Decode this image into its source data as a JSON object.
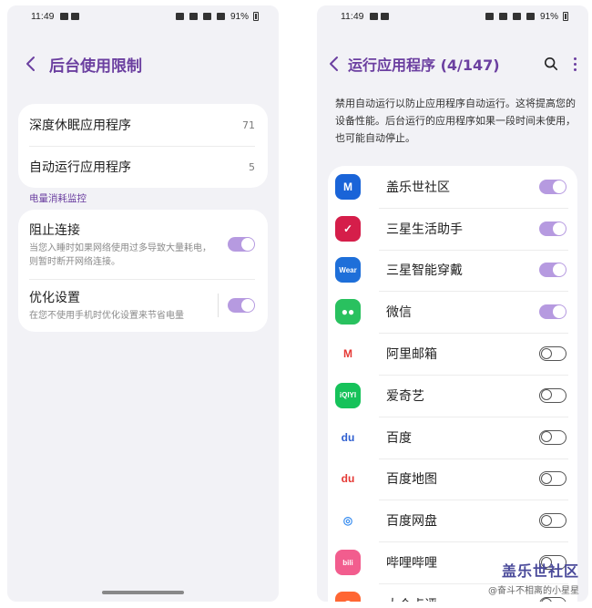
{
  "status_bar": {
    "time": "11:49",
    "battery": "91%"
  },
  "left": {
    "title": "后台使用限制",
    "items": [
      {
        "label": "深度休眠应用程序",
        "count": "71"
      },
      {
        "label": "自动运行应用程序",
        "count": "5"
      }
    ],
    "section_header": "电量消耗监控",
    "monitor": [
      {
        "label": "阻止连接",
        "desc": "当您入睡时如果网络使用过多导致大量耗电，则暂时断开网络连接。",
        "enabled": true
      },
      {
        "label": "优化设置",
        "desc": "在您不使用手机时优化设置来节省电量",
        "enabled": true
      }
    ]
  },
  "right": {
    "title": "运行应用程序 (4/147)",
    "description": "禁用自动运行以防止应用程序自动运行。这将提高您的设备性能。后台运行的应用程序如果一段时间未使用，也可能自动停止。",
    "apps": [
      {
        "name": "盖乐世社区",
        "icon": "galaxy-community-icon",
        "icon_text": "M",
        "color": "#1a64d8",
        "enabled": true
      },
      {
        "name": "三星生活助手",
        "icon": "samsung-life-icon",
        "icon_text": "✓",
        "color": "#d51e4a",
        "enabled": true
      },
      {
        "name": "三星智能穿戴",
        "icon": "galaxy-wearable-icon",
        "icon_text": "Wear",
        "color": "#1e6fd9",
        "enabled": true
      },
      {
        "name": "微信",
        "icon": "wechat-icon",
        "icon_text": "●●",
        "color": "#29c15f",
        "enabled": true
      },
      {
        "name": "阿里邮箱",
        "icon": "ali-mail-icon",
        "icon_text": "M",
        "color": "#ffffff",
        "enabled": false
      },
      {
        "name": "爱奇艺",
        "icon": "iqiyi-icon",
        "icon_text": "iQIYI",
        "color": "#16c25a",
        "enabled": false
      },
      {
        "name": "百度",
        "icon": "baidu-icon",
        "icon_text": "du",
        "color": "#ffffff",
        "enabled": false
      },
      {
        "name": "百度地图",
        "icon": "baidu-map-icon",
        "icon_text": "du",
        "color": "#ffffff",
        "enabled": false
      },
      {
        "name": "百度网盘",
        "icon": "baidu-netdisk-icon",
        "icon_text": "◎",
        "color": "#ffffff",
        "enabled": false
      },
      {
        "name": "哔哩哔哩",
        "icon": "bilibili-icon",
        "icon_text": "bili",
        "color": "#f25d8e",
        "enabled": false
      },
      {
        "name": "大众点评",
        "icon": "dianping-icon",
        "icon_text": "◉",
        "color": "#ff6633",
        "enabled": false
      }
    ]
  },
  "watermark": {
    "title": "盖乐世社区",
    "subtitle": "@奋斗不相离的小星星"
  }
}
